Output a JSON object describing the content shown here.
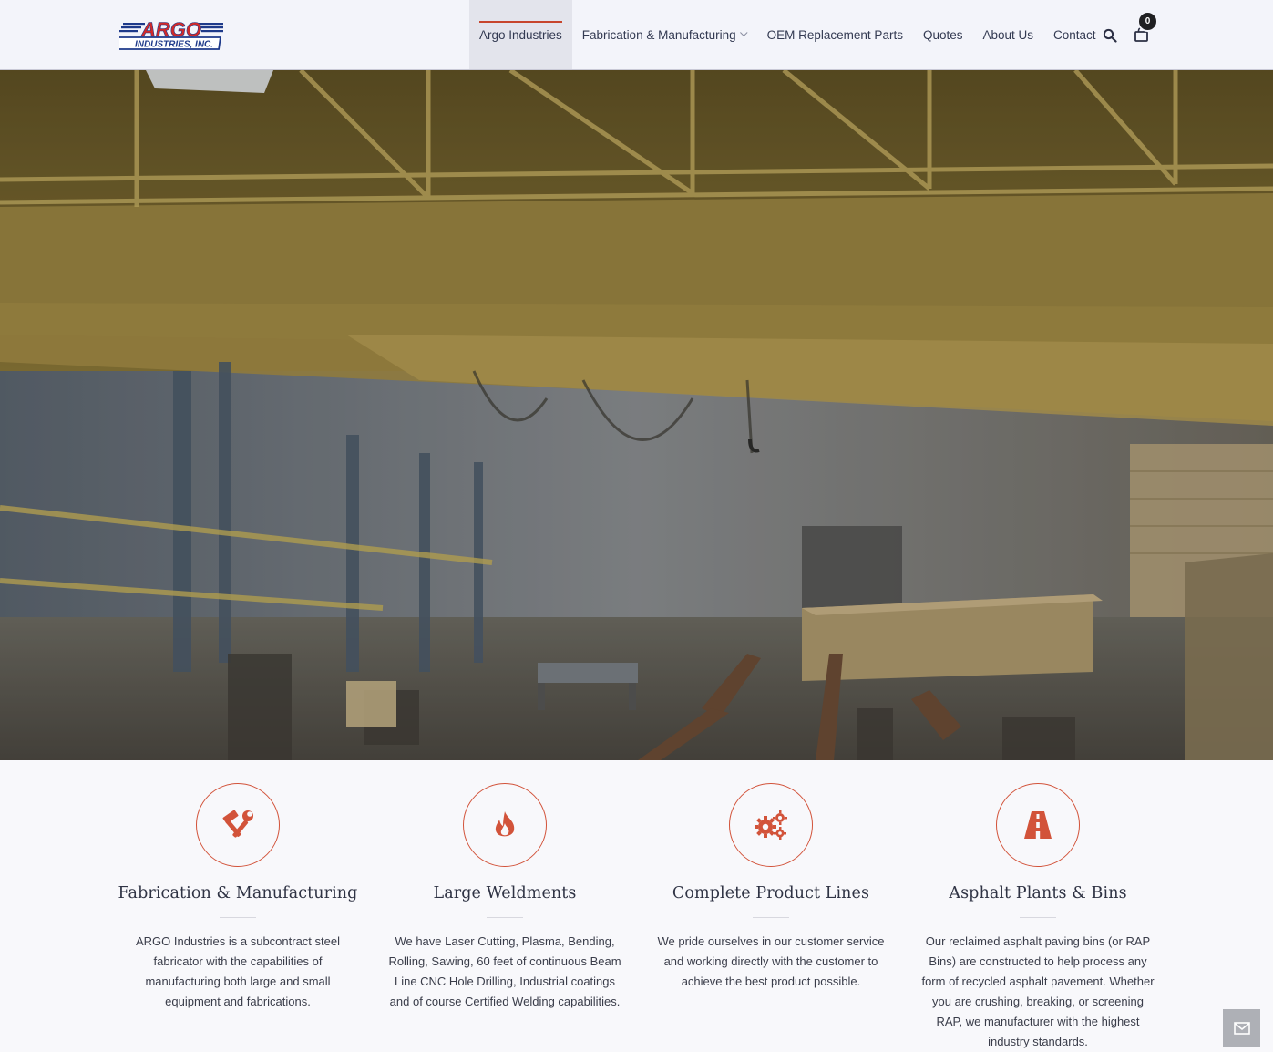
{
  "header": {
    "logo_text_top": "ARGO",
    "logo_text_bottom": "INDUSTRIES, INC.",
    "nav": [
      {
        "label": "Argo Industries",
        "active": true
      },
      {
        "label": "Fabrication & Manufacturing",
        "has_dropdown": true
      },
      {
        "label": "OEM Replacement Parts"
      },
      {
        "label": "Quotes"
      },
      {
        "label": "About Us"
      },
      {
        "label": "Contact"
      }
    ],
    "search_icon": "search-icon",
    "cart_icon": "shopping-bag-icon",
    "cart_count": "0"
  },
  "hero": {
    "image": "factory-interior-overhead-crane-photo"
  },
  "features": [
    {
      "icon": "hammer-wrench-icon",
      "title": "Fabrication & Manufacturing",
      "text": "ARGO Industries is a subcontract steel fabricator with the capabilities of manufacturing both large and small equipment and fabrications."
    },
    {
      "icon": "fire-icon",
      "title": "Large Weldments",
      "text": "We have Laser Cutting, Plasma, Bending, Rolling, Sawing, 60 feet of continuous Beam Line CNC Hole Drilling, Industrial coatings and of course Certified Welding capabilities."
    },
    {
      "icon": "gears-icon",
      "title": "Complete Product Lines",
      "text": "We pride ourselves in our customer service and working directly with the customer to achieve the best product possible."
    },
    {
      "icon": "road-icon",
      "title": "Asphalt Plants & Bins",
      "text": "Our reclaimed asphalt paving bins (or RAP Bins) are constructed to help process any form of recycled asphalt pavement. Whether you are crushing, breaking, or screening RAP, we manufacturer with the highest industry standards."
    }
  ],
  "floating": {
    "mail_icon": "envelope-icon"
  },
  "colors": {
    "accent": "#c7452d",
    "logo_red": "#d12a2a",
    "logo_blue": "#1e3a8a",
    "nav_text": "#333a52"
  }
}
